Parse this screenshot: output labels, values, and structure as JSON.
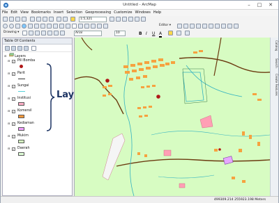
{
  "window": {
    "title": "Untitled - ArcMap",
    "minimize": "–",
    "maximize": "□",
    "close": "✕"
  },
  "menu": [
    "File",
    "Edit",
    "View",
    "Bookmarks",
    "Insert",
    "Selection",
    "Geoprocessing",
    "Customize",
    "Windows",
    "Help"
  ],
  "toolbar": {
    "scale": "1:5,321",
    "editor_label": "Editor ▾",
    "drawing_label": "Drawing ▾",
    "font_name": "Arial",
    "font_size": "10",
    "bold": "B",
    "italic": "I",
    "underline": "U",
    "font_color": "A"
  },
  "toc": {
    "title": "Table Of Contents",
    "root": "Layers",
    "layers": [
      {
        "name": "Pill Bomba",
        "symbol": "marker",
        "color": "#b01818"
      },
      {
        "name": "Parit",
        "symbol": "line",
        "color": "#3a3a3a"
      },
      {
        "name": "Sungai",
        "symbol": "line",
        "color": "#54d0d8"
      },
      {
        "name": "Institusi",
        "symbol": "polygon",
        "color": "#ffb0c8"
      },
      {
        "name": "Komersil",
        "symbol": "polygon",
        "color": "#ff9a3c"
      },
      {
        "name": "Kediaman",
        "symbol": "polygon",
        "color": "#f3a3ff"
      },
      {
        "name": "Mukim",
        "symbol": "polygon",
        "color": "#d7fcc2"
      },
      {
        "name": "Daerah",
        "symbol": "polygon",
        "color": "#e0ffd8"
      }
    ]
  },
  "annotation": "Layer",
  "side_tabs": [
    "Catalog",
    "Search",
    "Create Features"
  ],
  "status": {
    "coords": "499309.214  255923.198 Meters"
  },
  "colors": {
    "map_background": "#d7fcc2",
    "road": "#6b3a10",
    "river": "#35b3c0",
    "buildings": "#f6a23f",
    "institution": "#ff9fb5",
    "hydrant": "#b01818"
  }
}
